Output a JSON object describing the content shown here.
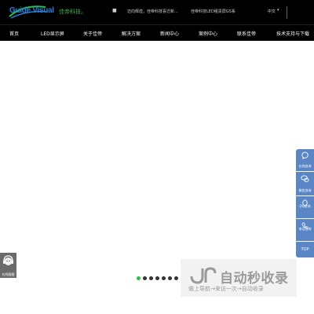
{
  "header": {
    "logo_text": "Guide Visual",
    "slogan": "佳帝科技。",
    "separator": "■",
    "news": [
      "迈向辉煌，佳帝科技喜迁新...",
      "佳帝科技LED租赁屏GS系"
    ],
    "language": "中文",
    "language_arrow": "▾"
  },
  "nav": {
    "items": [
      "首页",
      "LED显示屏",
      "关于佳帝",
      "解决方案",
      "新闻中心",
      "案例中心",
      "联系佳帝",
      "技术支持与下载"
    ]
  },
  "sidebar": {
    "items": [
      {
        "label": "在线咨询",
        "icon": "chat-icon"
      },
      {
        "label": "微信咨询",
        "icon": "wechat-icon"
      },
      {
        "label": "QQ咨询",
        "icon": "qq-icon"
      },
      {
        "label": "电话咨询",
        "icon": "phone-icon"
      },
      {
        "label": "TOP",
        "icon": "top-icon"
      }
    ]
  },
  "customer_service": {
    "label": "在线客服",
    "icon": "headset-icon"
  },
  "carousel": {
    "count": 7,
    "active_index": 0,
    "active_color": "#2dbe4e",
    "inactive_color": "#333333"
  },
  "watermark": {
    "main": "自动秒收录",
    "sub": "做上导航→来访一次→自动收录"
  },
  "colors": {
    "brand_blue": "#2a7fd8",
    "brand_green": "#3bb04a",
    "sidebar": "#5b86c5",
    "nav_bg": "#000000"
  }
}
